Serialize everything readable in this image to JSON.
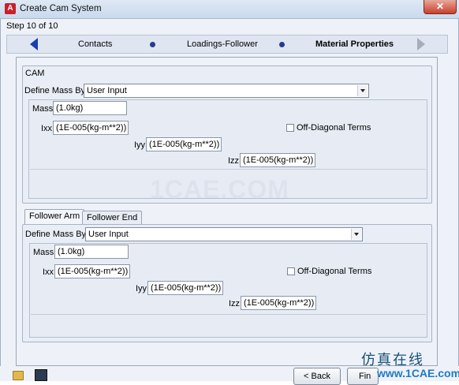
{
  "window": {
    "app_icon": "A",
    "title": "Create Cam System",
    "close_glyph": "✕"
  },
  "wizard": {
    "step_text": "Step 10 of 10",
    "prev_label": "Contacts",
    "middle_label": "Loadings-Follower",
    "current_label": "Material Properties"
  },
  "cam": {
    "group_title": "CAM",
    "define_mass_label": "Define Mass By",
    "define_mass_value": "User Input",
    "mass_label": "Mass",
    "mass_value": "(1.0kg)",
    "ixx_label": "Ixx",
    "ixx_value": "(1E-005(kg-m**2))",
    "iyy_label": "Iyy",
    "iyy_value": "(1E-005(kg-m**2))",
    "izz_label": "Izz",
    "izz_value": "(1E-005(kg-m**2))",
    "off_diagonal_label": "Off-Diagonal Terms"
  },
  "tabs": {
    "tab1": "Follower Arm",
    "tab2": "Follower End"
  },
  "follower": {
    "define_mass_label": "Define Mass By",
    "define_mass_value": "User Input",
    "mass_label": "Mass",
    "mass_value": "(1.0kg)",
    "ixx_label": "Ixx",
    "ixx_value": "(1E-005(kg-m**2))",
    "iyy_label": "Iyy",
    "iyy_value": "(1E-005(kg-m**2))",
    "izz_label": "Izz",
    "izz_value": "(1E-005(kg-m**2))",
    "off_diagonal_label": "Off-Diagonal Terms"
  },
  "watermark": "1CAE.COM",
  "buttons": {
    "back": "< Back",
    "finish": "Fin"
  },
  "brand": {
    "text": "仿真在线",
    "url": "www.1CAE.com"
  }
}
